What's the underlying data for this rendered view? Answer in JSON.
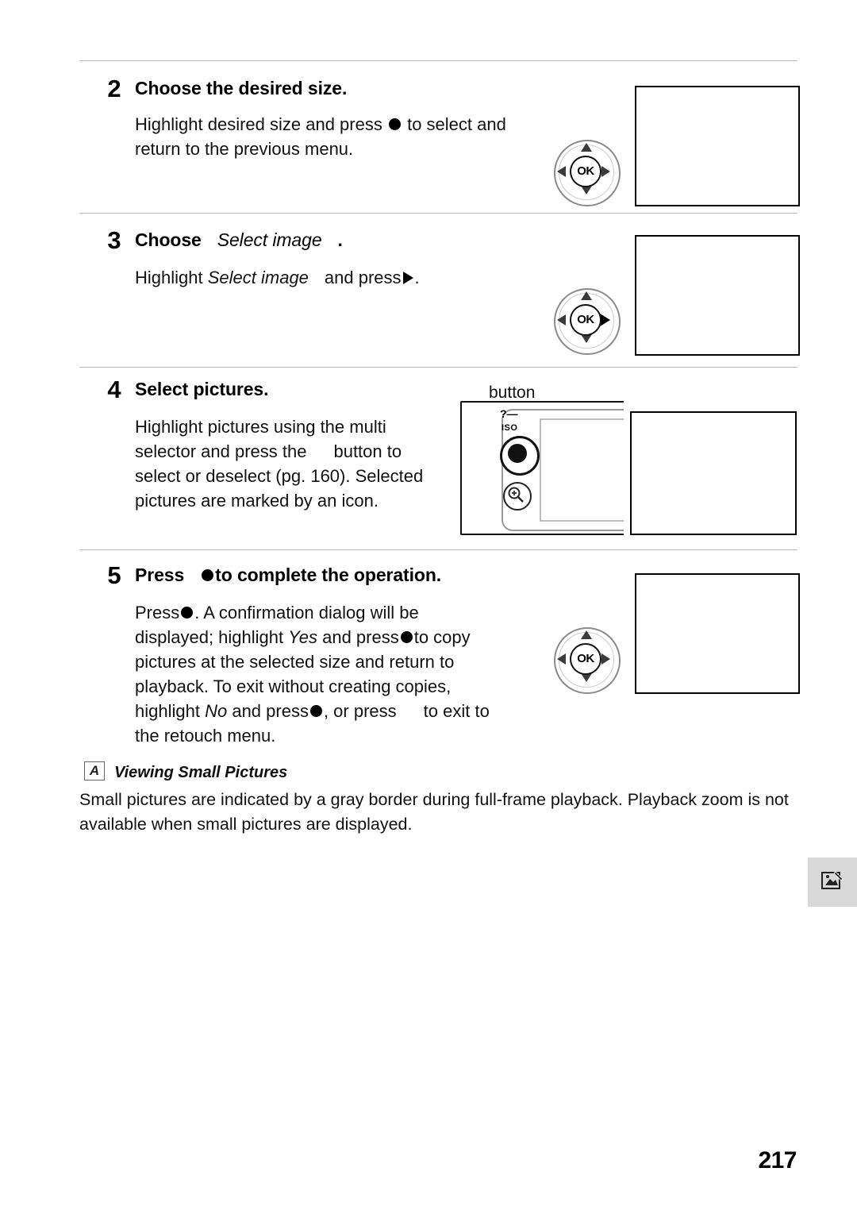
{
  "page": {
    "number": "217",
    "tab_icon": "retouch-menu-icon"
  },
  "steps": [
    {
      "num": "2",
      "head": "Choose the desired size.",
      "body_line1": "Highlight desired size and press",
      "body_line1b": "to select and",
      "body_line2": "return to the previous menu.",
      "control": "multi-selector-ok"
    },
    {
      "num": "3",
      "head_pre": "Choose",
      "head_ital": "Select image",
      "head_post": ".",
      "body_pre": "Highlight",
      "body_ital": "Select image",
      "body_post": "and press",
      "body_end": ".",
      "control": "multi-selector-right"
    },
    {
      "num": "4",
      "head": "Select pictures.",
      "body_line1": "Highlight pictures using the multi",
      "body_line2a": "selector and press the",
      "body_line2b": "button to",
      "body_line3": "select or deselect (pg. 160).  Selected",
      "body_line4": "pictures are marked by an icon.",
      "callout": "button",
      "camera_labels": {
        "qm": "?",
        "iso": "ISO",
        "zoom": "zoom-in-icon"
      }
    },
    {
      "num": "5",
      "head_pre": "Press",
      "head_post": "to complete the operation.",
      "body_line1a": "Press",
      "body_line1b": ".  A confirmation dialog will be",
      "body_line2a": "displayed; highlight",
      "body_line2_yes": "Yes",
      "body_line2b": "and press",
      "body_line2c": "to copy",
      "body_line3": "pictures at the selected size and return to",
      "body_line4": "playback.  To exit without creating copies,",
      "body_line5a": "highlight",
      "body_line5_no": "No",
      "body_line5b": "and press",
      "body_line5c": ", or press",
      "body_line5d": "to exit to",
      "body_line6": "the retouch menu.",
      "control": "multi-selector-ok"
    }
  ],
  "note": {
    "marker": "A",
    "title": "Viewing Small Pictures",
    "line1": "Small pictures are indicated by a gray border during full-frame playback.  Playback zoom is not",
    "line2": "available when small pictures are displayed."
  },
  "screens": {
    "step2_caption": "",
    "step3_caption": "",
    "step4_caption": "",
    "step5_caption": ""
  }
}
